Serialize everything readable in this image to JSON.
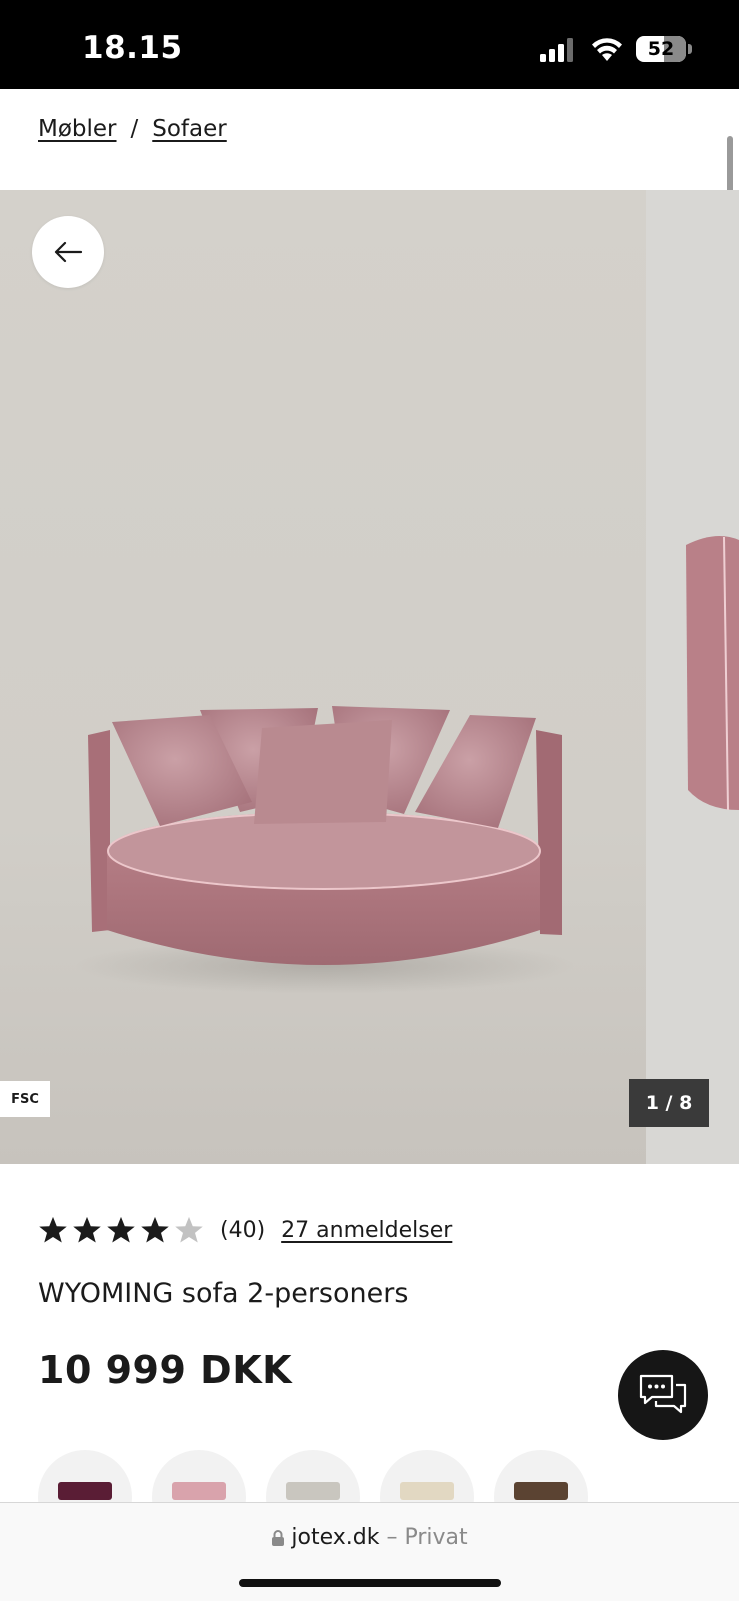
{
  "status_bar": {
    "time": "18.15",
    "battery": "52"
  },
  "breadcrumb": {
    "items": [
      "Møbler",
      "Sofaer"
    ],
    "separator": "/"
  },
  "gallery": {
    "badge": "FSC",
    "counter": "1 / 8"
  },
  "product": {
    "rating_count": "(40)",
    "reviews_link": "27 anmeldelser",
    "rating_stars": 4,
    "title": "WYOMING sofa 2-personers",
    "price": "10 999 DKK"
  },
  "colors": {
    "sofa": "#b9828a",
    "background": "#d6d3ce",
    "swatches": [
      "#5a1d35",
      "#d9a3ac",
      "#c9c6bf",
      "#e2d8c2",
      "#5b4332"
    ]
  },
  "browser": {
    "host": "jotex.dk",
    "mode": "– Privat"
  }
}
